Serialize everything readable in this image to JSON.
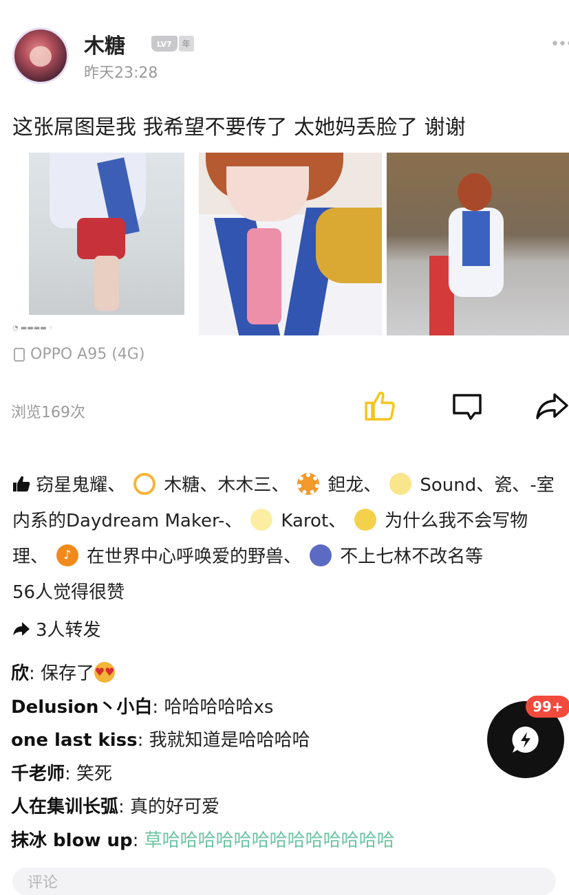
{
  "header": {
    "username": "木糖",
    "level": "LV7",
    "level_suffix": "年",
    "time": "昨天23:28",
    "more_icon": "more-dots-icon"
  },
  "post": {
    "text": "这张屌图是我 我希望不要传了 太她妈丢脸了 谢谢",
    "device": "OPPO A95 (4G)",
    "views": "浏览169次"
  },
  "likes": {
    "names": [
      "窃星鬼耀",
      "木糖",
      "木木三",
      "鉭龙",
      "Sound",
      "瓷",
      "-室内系的Daydream Maker-",
      "Karot",
      "为什么我不会写物理",
      "在世界中心呼唤爱的野兽",
      "不上七林不改名等"
    ],
    "summary": "56人觉得很赞"
  },
  "forward": {
    "text": "3人转发"
  },
  "comments": [
    {
      "name": "欣",
      "text": "保存了"
    },
    {
      "name": "Delusion丶小白",
      "text": "哈哈哈哈哈xs"
    },
    {
      "name": "one last kiss",
      "text": "我就知道是哈哈哈哈"
    },
    {
      "name": "千老师",
      "text": "笑死"
    },
    {
      "name": "人在集训长弧",
      "text": "真的好可爱"
    },
    {
      "name": "抹冰 blow up",
      "text": "草哈哈哈哈哈哈哈哈哈哈哈哈哈"
    }
  ],
  "fab": {
    "badge": "99+"
  },
  "input": {
    "placeholder": "评论"
  },
  "colors": {
    "like_yellow": "#f5c518",
    "badge_red": "#f24a3c",
    "comment_green": "#6cc4a2"
  }
}
